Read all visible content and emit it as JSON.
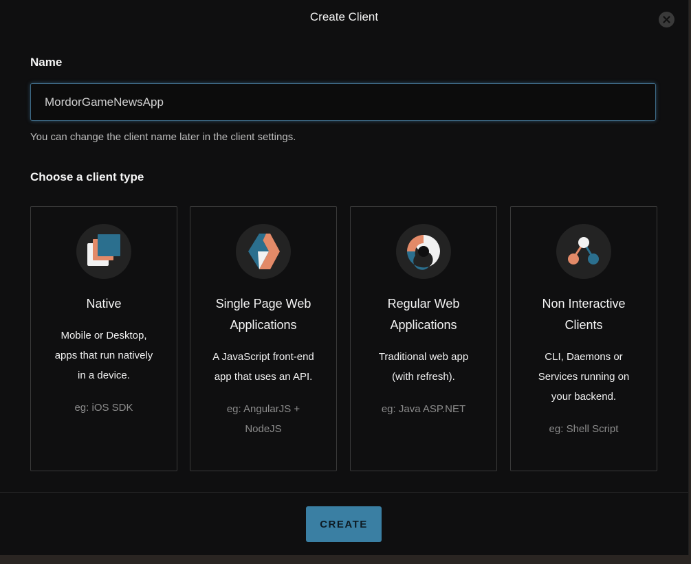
{
  "modal": {
    "title": "Create Client"
  },
  "name_field": {
    "label": "Name",
    "value": "MordorGameNewsApp",
    "hint": "You can change the client name later in the client settings."
  },
  "client_type": {
    "label": "Choose a client type",
    "cards": [
      {
        "icon": "native-app-icon",
        "title_lines": [
          "Native"
        ],
        "desc_lines": [
          "Mobile or Desktop,",
          "apps that run natively",
          "in a device."
        ],
        "example_lines": [
          "eg: iOS SDK"
        ]
      },
      {
        "icon": "single-page-app-icon",
        "title_lines": [
          "Single Page Web",
          "Applications"
        ],
        "desc_lines": [
          "A JavaScript front-end",
          "app that uses an API."
        ],
        "example_lines": [
          "eg: AngularJS +",
          "NodeJS"
        ]
      },
      {
        "icon": "regular-web-app-icon",
        "title_lines": [
          "Regular Web",
          "Applications"
        ],
        "desc_lines": [
          "Traditional web app",
          "(with refresh)."
        ],
        "example_lines": [
          "eg: Java ASP.NET"
        ]
      },
      {
        "icon": "non-interactive-client-icon",
        "title_lines": [
          "Non Interactive",
          "Clients"
        ],
        "desc_lines": [
          "CLI, Daemons or",
          "Services running on",
          "your backend."
        ],
        "example_lines": [
          "eg: Shell Script"
        ]
      }
    ]
  },
  "footer": {
    "create_label": "CREATE"
  },
  "colors": {
    "accent": "#3a7fa3",
    "orange": "#e38a68",
    "blue": "#2b6f8e",
    "white": "#f2f2f2"
  }
}
